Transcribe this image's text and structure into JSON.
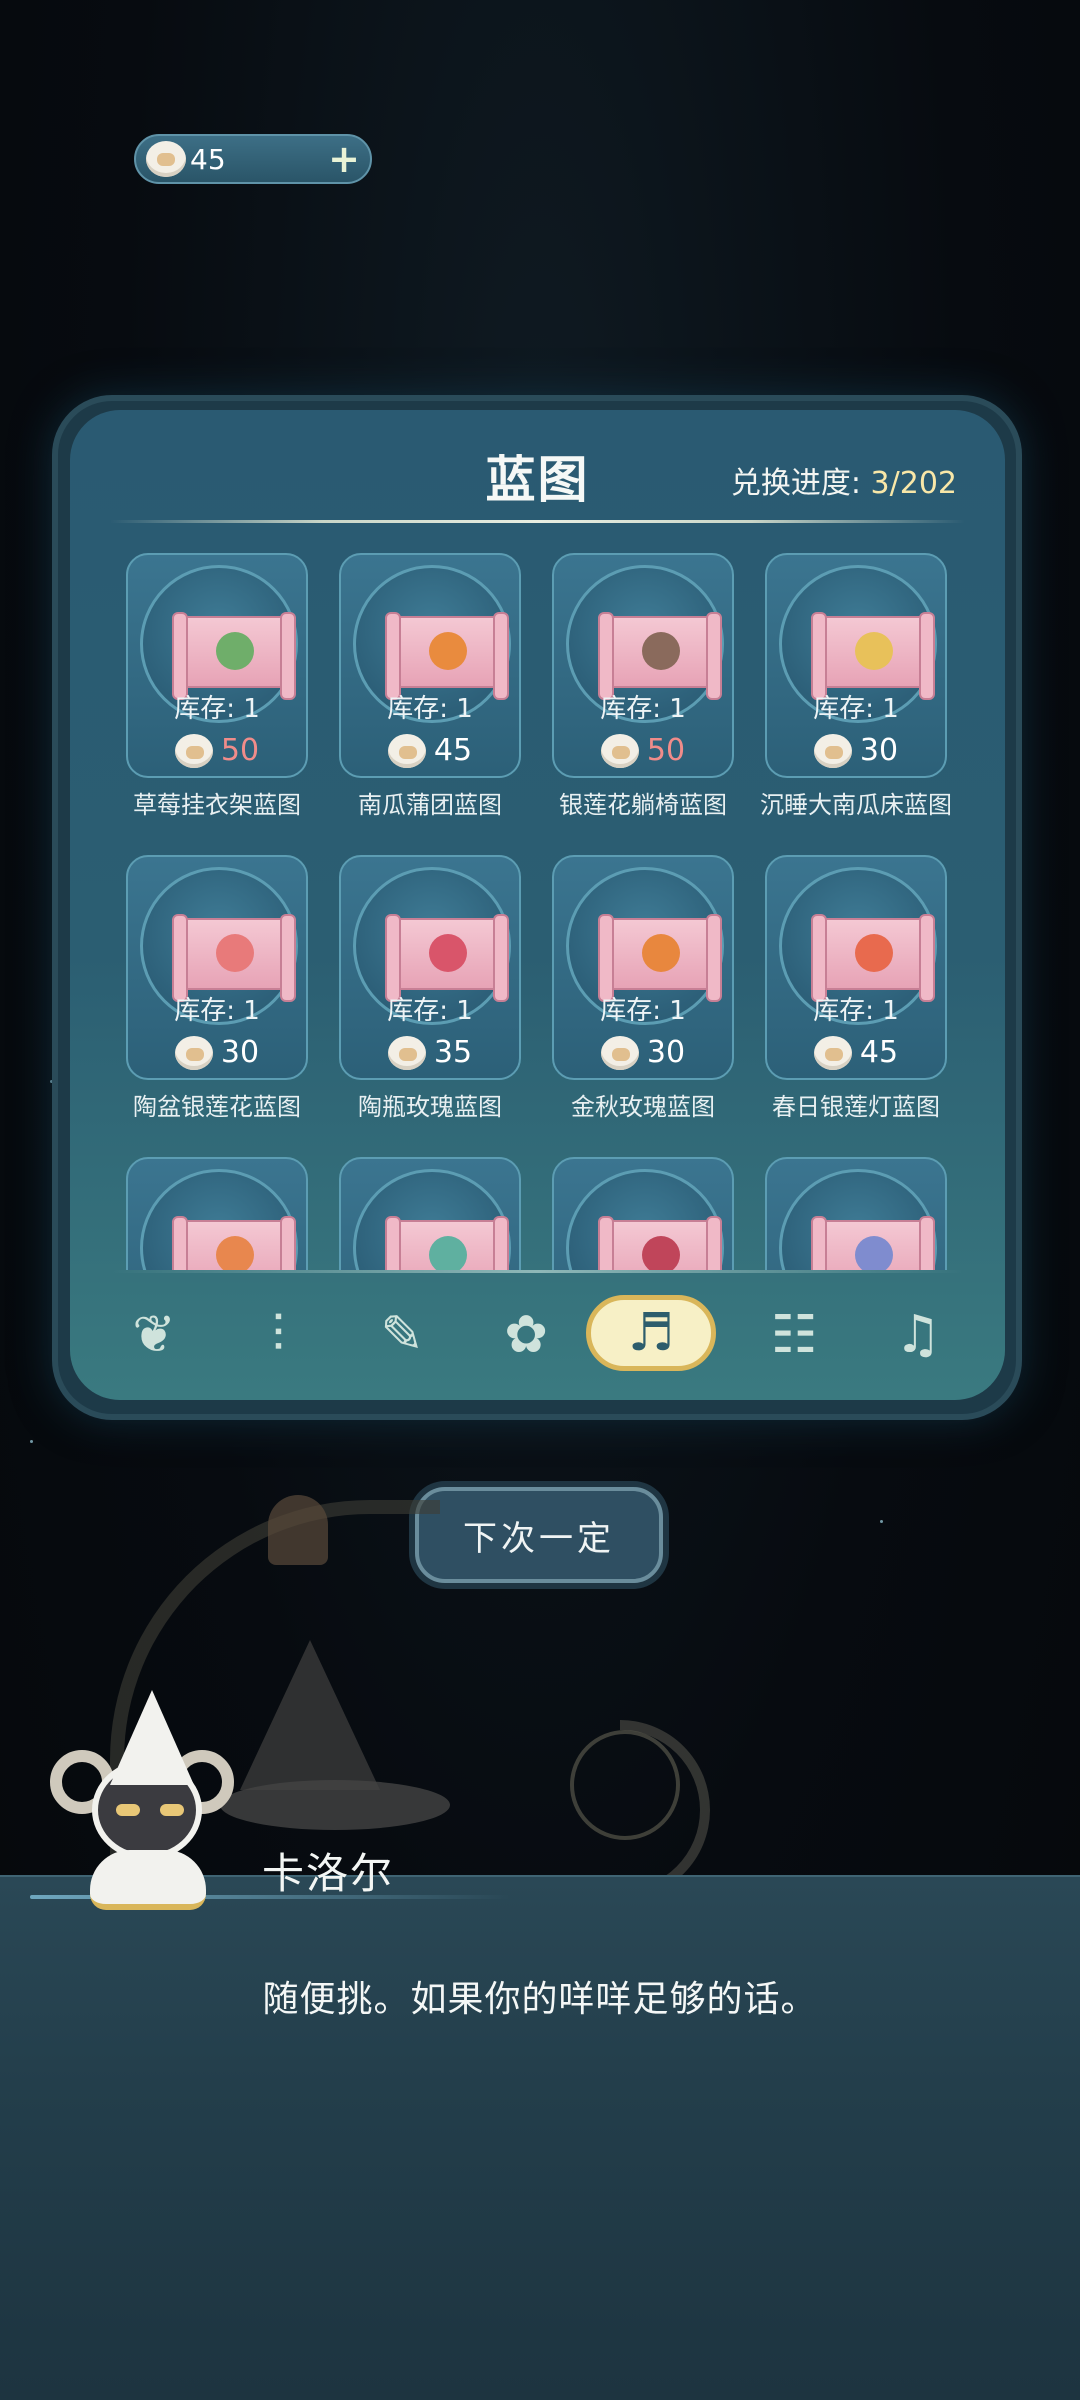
{
  "currency": {
    "amount": "45",
    "icon": "sheep-coin-icon",
    "add_icon": "+"
  },
  "panel": {
    "title": "蓝图",
    "progress_label": "兑换进度: ",
    "progress_value": "3/202"
  },
  "items": [
    {
      "name": "草莓挂衣架蓝图",
      "stock": "库存: 1",
      "price": "50",
      "affordable": false,
      "deco_color": "#6fae6a"
    },
    {
      "name": "南瓜蒲团蓝图",
      "stock": "库存: 1",
      "price": "45",
      "affordable": true,
      "deco_color": "#e98b3e"
    },
    {
      "name": "银莲花躺椅蓝图",
      "stock": "库存: 1",
      "price": "50",
      "affordable": false,
      "deco_color": "#8a6a5c"
    },
    {
      "name": "沉睡大南瓜床蓝图",
      "stock": "库存: 1",
      "price": "30",
      "affordable": true,
      "deco_color": "#e8c15a"
    },
    {
      "name": "陶盆银莲花蓝图",
      "stock": "库存: 1",
      "price": "30",
      "affordable": true,
      "deco_color": "#e87a7a"
    },
    {
      "name": "陶瓶玫瑰蓝图",
      "stock": "库存: 1",
      "price": "35",
      "affordable": true,
      "deco_color": "#d9556a"
    },
    {
      "name": "金秋玫瑰蓝图",
      "stock": "库存: 1",
      "price": "30",
      "affordable": true,
      "deco_color": "#e8873e"
    },
    {
      "name": "春日银莲灯蓝图",
      "stock": "库存: 1",
      "price": "45",
      "affordable": true,
      "deco_color": "#e86a4e"
    },
    {
      "name": "",
      "stock": "",
      "price": "",
      "affordable": true,
      "deco_color": "#e8874e"
    },
    {
      "name": "",
      "stock": "",
      "price": "",
      "affordable": true,
      "deco_color": "#5fb0a0"
    },
    {
      "name": "",
      "stock": "",
      "price": "",
      "affordable": true,
      "deco_color": "#c0455a"
    },
    {
      "name": "",
      "stock": "",
      "price": "",
      "affordable": true,
      "deco_color": "#7f8ccf"
    }
  ],
  "tabs": [
    {
      "id": "plant",
      "icon": "sprout-icon",
      "glyph": "❦",
      "active": false
    },
    {
      "id": "decor",
      "icon": "rug-icon",
      "glyph": "⫶",
      "active": false
    },
    {
      "id": "tools",
      "icon": "tools-icon",
      "glyph": "✎",
      "active": false
    },
    {
      "id": "lamp",
      "icon": "lamp-icon",
      "glyph": "✿",
      "active": false
    },
    {
      "id": "blueprint",
      "icon": "blueprint-icon",
      "glyph": "♬",
      "active": true
    },
    {
      "id": "furniture",
      "icon": "shelf-icon",
      "glyph": "☷",
      "active": false
    },
    {
      "id": "music",
      "icon": "record-icon",
      "glyph": "♫",
      "active": false
    }
  ],
  "next_button": "下次一定",
  "dialog": {
    "speaker": "卡洛尔",
    "text": "随便挑。如果你的咩咩足够的话。"
  },
  "colors": {
    "affordable_price": "#ffffff",
    "unaffordable_price": "#f08c8a",
    "progress_value": "#f8e7a8",
    "active_tab_bg": "#f7f0c6"
  }
}
